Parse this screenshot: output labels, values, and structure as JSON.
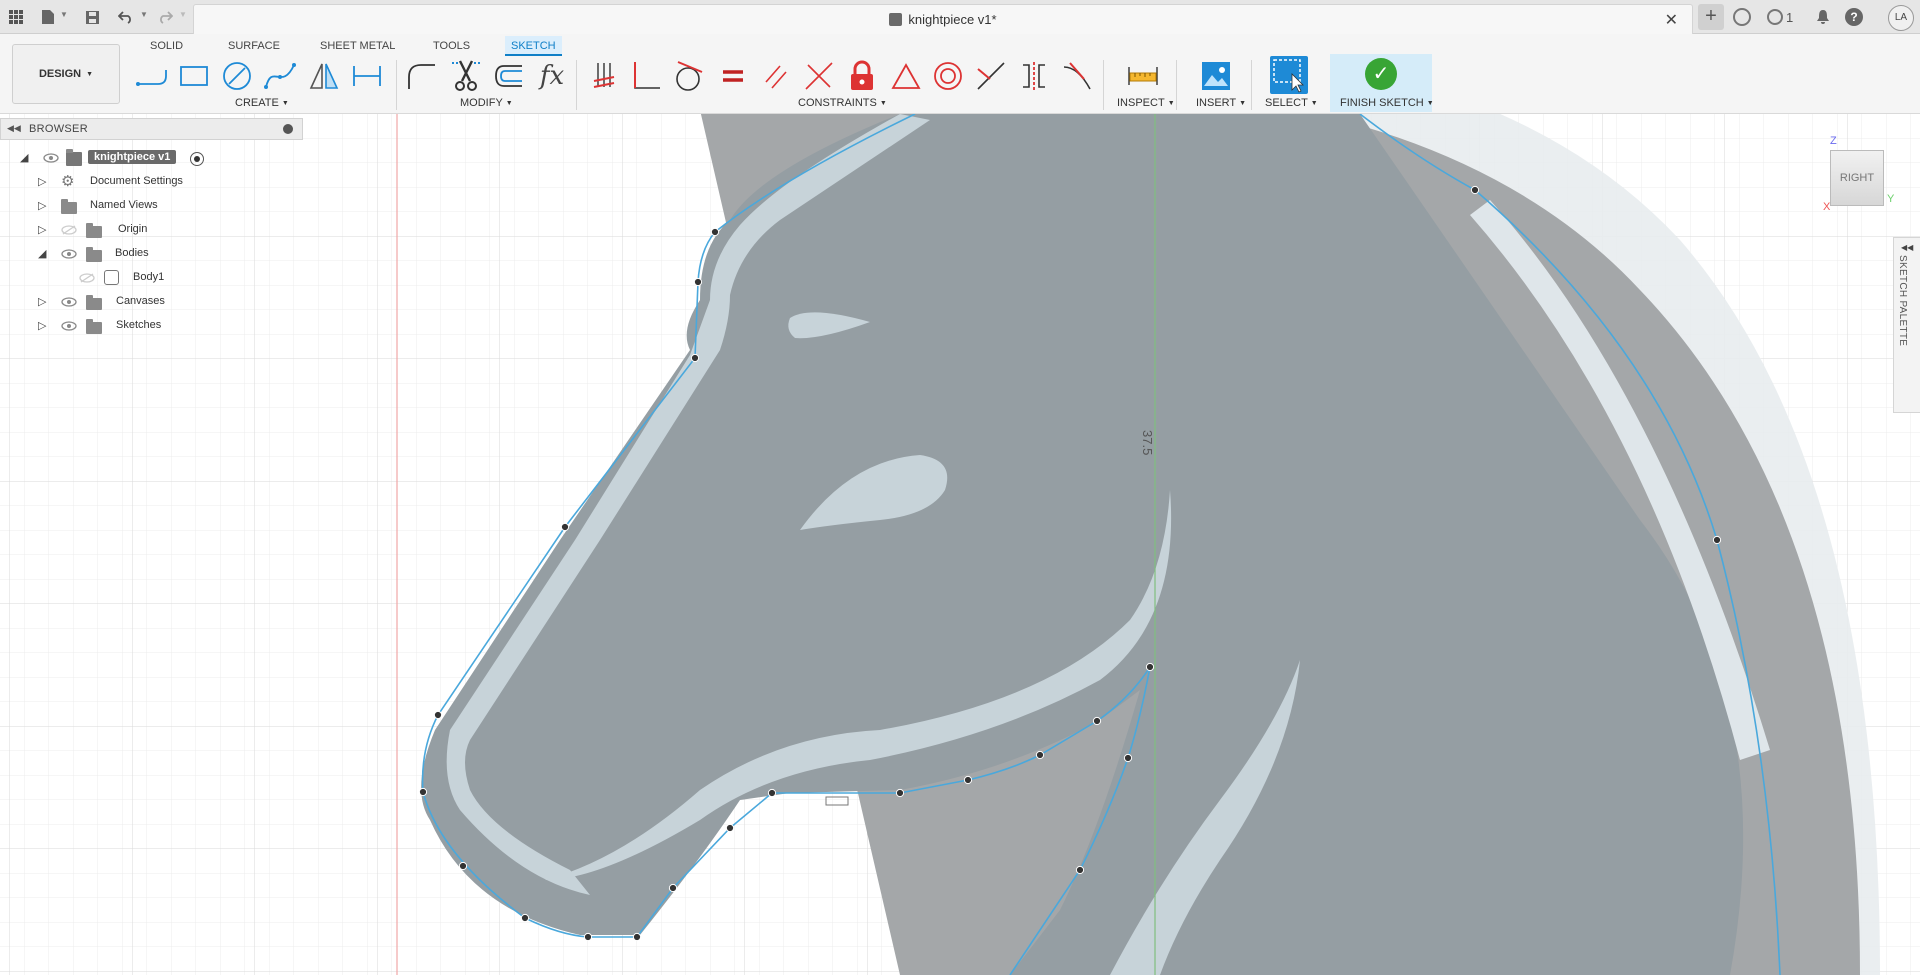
{
  "titlebar": {
    "document_title": "knightpiece v1*",
    "close_symbol": "✕",
    "new_tab_symbol": "+",
    "job_status_count": "1",
    "user_initials": "LA"
  },
  "toolbar": {
    "workspace": "DESIGN",
    "tabs": [
      "SOLID",
      "SURFACE",
      "SHEET METAL",
      "TOOLS",
      "SKETCH"
    ],
    "active_tab": "SKETCH",
    "groups": {
      "create": "CREATE",
      "modify": "MODIFY",
      "constraints": "CONSTRAINTS",
      "inspect": "INSPECT",
      "insert": "INSERT",
      "select": "SELECT",
      "finish": "FINISH SKETCH"
    }
  },
  "browser": {
    "title": "BROWSER",
    "root": "knightpiece v1",
    "items": [
      {
        "label": "Document Settings",
        "icon": "gear-icon"
      },
      {
        "label": "Named Views",
        "icon": "folder-icon"
      },
      {
        "label": "Origin",
        "icon": "folder-icon"
      },
      {
        "label": "Bodies",
        "icon": "folder-icon"
      },
      {
        "label": "Body1",
        "icon": "body-icon"
      },
      {
        "label": "Canvases",
        "icon": "folder-icon"
      },
      {
        "label": "Sketches",
        "icon": "folder-icon"
      }
    ]
  },
  "viewcube": {
    "face": "RIGHT",
    "axis_z": "Z",
    "axis_y": "Y",
    "axis_x": "X"
  },
  "sketch_palette": {
    "label": "SKETCH PALETTE"
  },
  "canvas": {
    "dimension_label": "37.5"
  },
  "colors": {
    "accent": "#0f7fc7",
    "sketch_line": "#4aa8dc",
    "canvas_image": "#9ea6aa",
    "finish_green": "#38a535"
  }
}
